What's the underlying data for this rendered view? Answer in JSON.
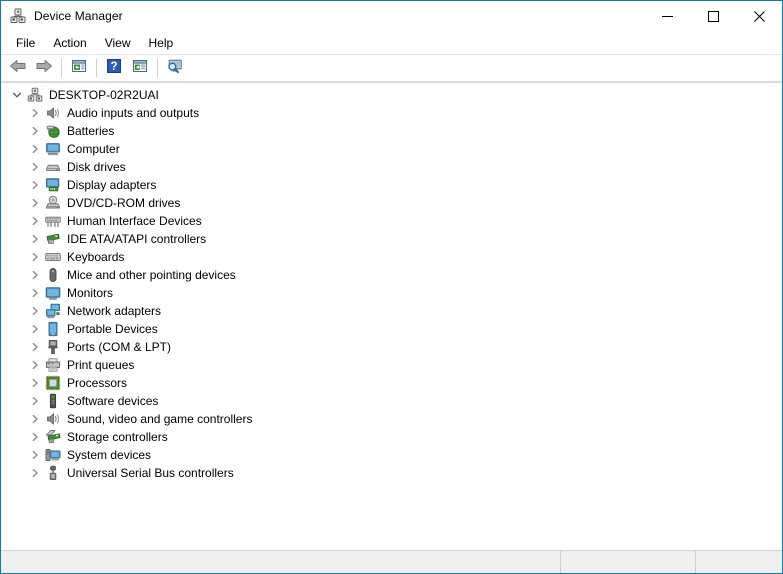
{
  "window": {
    "title": "Device Manager",
    "icon": "device-manager-icon",
    "accent_color": "#0d7ea8",
    "controls": [
      {
        "name": "minimize",
        "label": "–"
      },
      {
        "name": "maximize",
        "label": "□"
      },
      {
        "name": "close",
        "label": "✕"
      }
    ]
  },
  "menubar": {
    "items": [
      {
        "label": "File"
      },
      {
        "label": "Action"
      },
      {
        "label": "View"
      },
      {
        "label": "Help"
      }
    ]
  },
  "toolbar": {
    "buttons": [
      {
        "name": "back-button",
        "icon": "back-arrow-icon",
        "tooltip": "Back"
      },
      {
        "name": "forward-button",
        "icon": "forward-arrow-icon",
        "tooltip": "Forward"
      },
      {
        "name": "properties-button",
        "icon": "properties-icon",
        "tooltip": "Properties"
      },
      {
        "name": "help-button",
        "icon": "help-question-icon",
        "tooltip": "Help"
      },
      {
        "name": "update-driver-button",
        "icon": "update-driver-icon",
        "tooltip": "Update driver"
      },
      {
        "name": "scan-hardware-button",
        "icon": "scan-hardware-changes-icon",
        "tooltip": "Scan for hardware changes"
      }
    ]
  },
  "tree": {
    "root": {
      "label": "DESKTOP-02R2UAI",
      "icon": "computer-root-icon",
      "expanded": true
    },
    "nodes": [
      {
        "label": "Audio inputs and outputs",
        "icon": "speaker-icon",
        "expanded": false
      },
      {
        "label": "Batteries",
        "icon": "battery-icon",
        "expanded": false
      },
      {
        "label": "Computer",
        "icon": "computer-icon",
        "expanded": false
      },
      {
        "label": "Disk drives",
        "icon": "disk-drive-icon",
        "expanded": false
      },
      {
        "label": "Display adapters",
        "icon": "display-adapter-icon",
        "expanded": false
      },
      {
        "label": "DVD/CD-ROM drives",
        "icon": "dvd-drive-icon",
        "expanded": false
      },
      {
        "label": "Human Interface Devices",
        "icon": "hid-icon",
        "expanded": false
      },
      {
        "label": "IDE ATA/ATAPI controllers",
        "icon": "ide-controller-icon",
        "expanded": false
      },
      {
        "label": "Keyboards",
        "icon": "keyboard-icon",
        "expanded": false
      },
      {
        "label": "Mice and other pointing devices",
        "icon": "mouse-icon",
        "expanded": false
      },
      {
        "label": "Monitors",
        "icon": "monitor-icon",
        "expanded": false
      },
      {
        "label": "Network adapters",
        "icon": "network-adapter-icon",
        "expanded": false
      },
      {
        "label": "Portable Devices",
        "icon": "portable-device-icon",
        "expanded": false
      },
      {
        "label": "Ports (COM & LPT)",
        "icon": "port-icon",
        "expanded": false
      },
      {
        "label": "Print queues",
        "icon": "printer-icon",
        "expanded": false
      },
      {
        "label": "Processors",
        "icon": "processor-icon",
        "expanded": false
      },
      {
        "label": "Software devices",
        "icon": "software-device-icon",
        "expanded": false
      },
      {
        "label": "Sound, video and game controllers",
        "icon": "sound-controller-icon",
        "expanded": false
      },
      {
        "label": "Storage controllers",
        "icon": "storage-controller-icon",
        "expanded": false
      },
      {
        "label": "System devices",
        "icon": "system-device-icon",
        "expanded": false
      },
      {
        "label": "Universal Serial Bus controllers",
        "icon": "usb-controller-icon",
        "expanded": false
      }
    ]
  },
  "statusbar": {
    "pane1": "",
    "pane2": "",
    "pane3": ""
  }
}
